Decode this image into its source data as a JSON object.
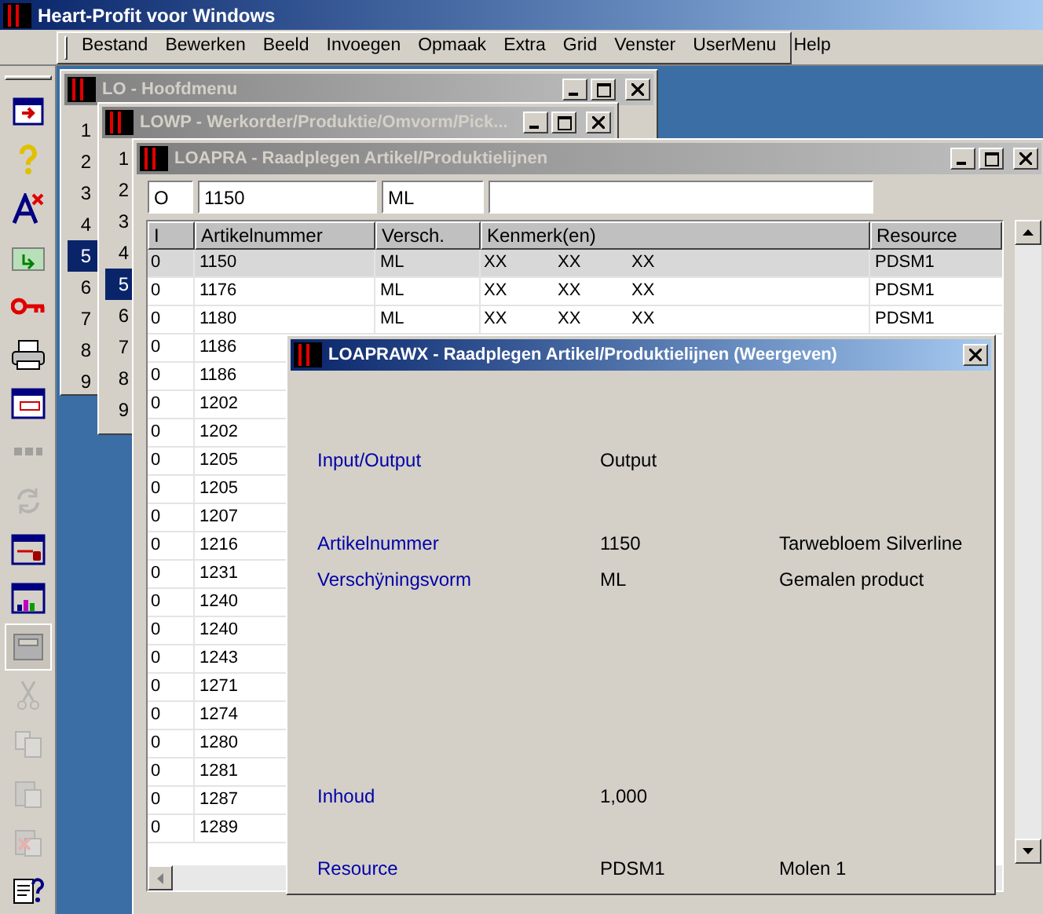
{
  "app": {
    "title": "Heart-Profit voor Windows"
  },
  "menu": [
    "Bestand",
    "Bewerken",
    "Beeld",
    "Invoegen",
    "Opmaak",
    "Extra",
    "Grid",
    "Venster",
    "UserMenu",
    "Help"
  ],
  "toolbar": [
    {
      "disabled": false,
      "pressed": false
    },
    {
      "disabled": false,
      "pressed": false
    },
    {
      "disabled": false,
      "pressed": false
    },
    {
      "disabled": false,
      "pressed": false
    },
    {
      "disabled": false,
      "pressed": false
    },
    {
      "disabled": false,
      "pressed": false
    },
    {
      "disabled": false,
      "pressed": false
    },
    {
      "disabled": true,
      "pressed": false
    },
    {
      "disabled": true,
      "pressed": false
    },
    {
      "disabled": false,
      "pressed": false
    },
    {
      "disabled": false,
      "pressed": false
    },
    {
      "disabled": false,
      "pressed": true
    },
    {
      "disabled": true,
      "pressed": false
    },
    {
      "disabled": true,
      "pressed": false
    },
    {
      "disabled": true,
      "pressed": false
    },
    {
      "disabled": true,
      "pressed": false
    },
    {
      "disabled": false,
      "pressed": false
    }
  ],
  "main_menu": {
    "title": "LO - Hoofdmenu",
    "active": false,
    "items": [
      {
        "label": "1",
        "selected": false
      },
      {
        "label": "2",
        "selected": false
      },
      {
        "label": "3",
        "selected": false
      },
      {
        "label": "4",
        "selected": false
      },
      {
        "label": "5",
        "selected": true
      },
      {
        "label": "6",
        "selected": false
      },
      {
        "label": "7",
        "selected": false
      },
      {
        "label": "8",
        "selected": false
      },
      {
        "label": "9",
        "selected": false
      }
    ]
  },
  "work_order": {
    "title": "LOWP - Werkorder/Produktie/Omvorm/Pick...",
    "active": false,
    "items": [
      {
        "label": "1",
        "selected": false
      },
      {
        "label": "2",
        "selected": false
      },
      {
        "label": "3",
        "selected": false
      },
      {
        "label": "4",
        "selected": false
      },
      {
        "label": "5",
        "selected": true
      },
      {
        "label": "6",
        "selected": false
      },
      {
        "label": "7",
        "selected": false
      },
      {
        "label": "8",
        "selected": false
      },
      {
        "label": "9",
        "selected": false
      }
    ]
  },
  "article_lines": {
    "title": "LOAPRA - Raadplegen Artikel/Produktielijnen",
    "active": false,
    "filters": [
      "O",
      "1150",
      "ML"
    ],
    "table": {
      "columns": [
        "I",
        "Artikelnummer",
        "Versch.",
        "Kenmerk(en)",
        "Resource"
      ],
      "rows": [
        {
          "i": "0",
          "artikelnummer": "1150",
          "versch": "ML",
          "kenmerken": [
            "XX",
            "XX",
            "XX"
          ],
          "resource": "PDSM1",
          "selected": true
        },
        {
          "i": "0",
          "artikelnummer": "1176",
          "versch": "ML",
          "kenmerken": [
            "XX",
            "XX",
            "XX"
          ],
          "resource": "PDSM1",
          "selected": false
        },
        {
          "i": "0",
          "artikelnummer": "1180",
          "versch": "ML",
          "kenmerken": [
            "XX",
            "XX",
            "XX"
          ],
          "resource": "PDSM1",
          "selected": false
        },
        {
          "i": "0",
          "artikelnummer": "1186",
          "selected": false
        },
        {
          "i": "0",
          "artikelnummer": "1186",
          "selected": false
        },
        {
          "i": "0",
          "artikelnummer": "1202",
          "selected": false
        },
        {
          "i": "0",
          "artikelnummer": "1202",
          "selected": false
        },
        {
          "i": "0",
          "artikelnummer": "1205",
          "selected": false
        },
        {
          "i": "0",
          "artikelnummer": "1205",
          "selected": false
        },
        {
          "i": "0",
          "artikelnummer": "1207",
          "selected": false
        },
        {
          "i": "0",
          "artikelnummer": "1216",
          "selected": false
        },
        {
          "i": "0",
          "artikelnummer": "1231",
          "selected": false
        },
        {
          "i": "0",
          "artikelnummer": "1240",
          "selected": false
        },
        {
          "i": "0",
          "artikelnummer": "1240",
          "selected": false
        },
        {
          "i": "0",
          "artikelnummer": "1243",
          "selected": false
        },
        {
          "i": "0",
          "artikelnummer": "1271",
          "selected": false
        },
        {
          "i": "0",
          "artikelnummer": "1274",
          "selected": false
        },
        {
          "i": "0",
          "artikelnummer": "1280",
          "selected": false
        },
        {
          "i": "0",
          "artikelnummer": "1281",
          "selected": false
        },
        {
          "i": "0",
          "artikelnummer": "1287",
          "selected": false
        },
        {
          "i": "0",
          "artikelnummer": "1289",
          "selected": false
        }
      ]
    }
  },
  "detail_dialog": {
    "title": "LOAPRAWX - Raadplegen Artikel/Produktielijnen (Weergeven)",
    "active": true,
    "fields": [
      {
        "label": "Input/Output",
        "value": "Output"
      },
      {
        "label": "Artikelnummer",
        "value": "1150",
        "description": "Tarwebloem Silverline"
      },
      {
        "label": "Verschÿningsvorm",
        "value": "ML",
        "description": "Gemalen product"
      },
      {
        "label": "Inhoud",
        "value": "1,000"
      },
      {
        "label": "Resource",
        "value": "PDSM1",
        "description": "Molen 1"
      }
    ]
  }
}
